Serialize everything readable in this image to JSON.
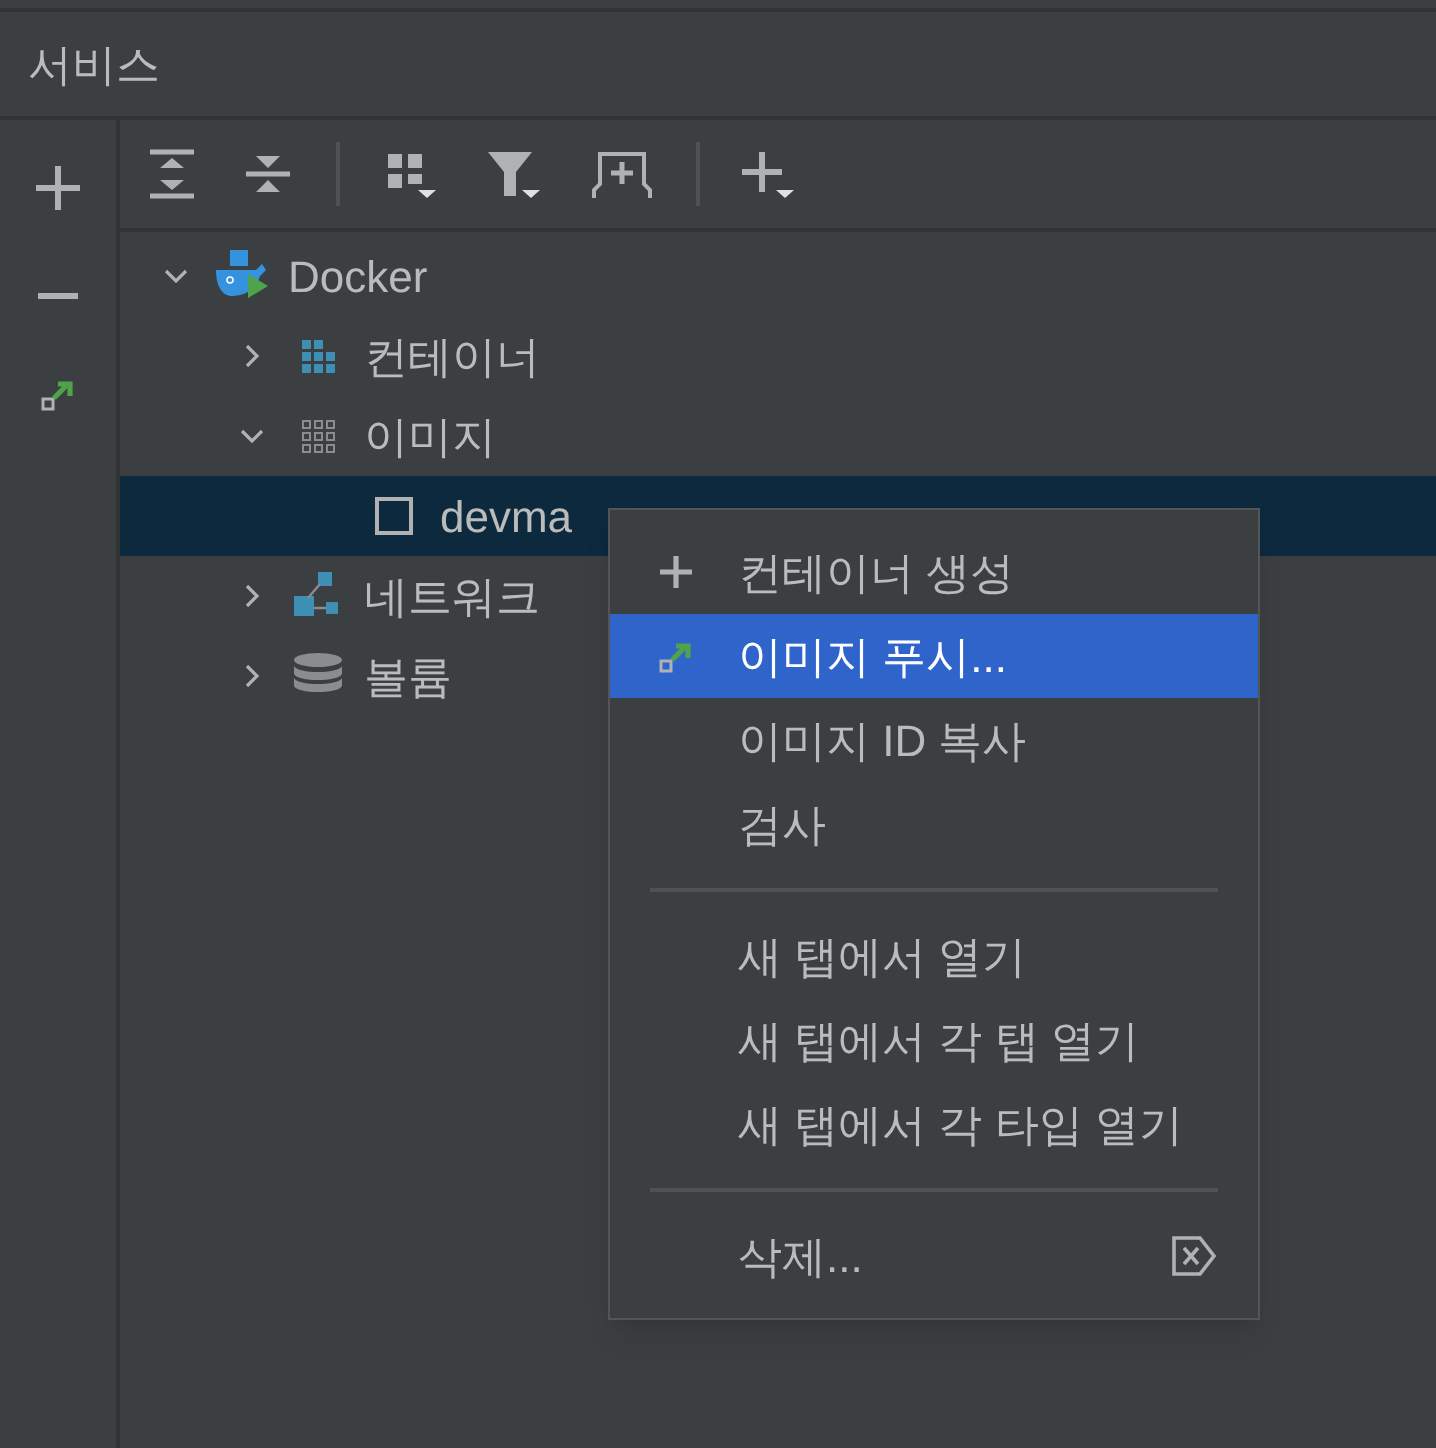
{
  "panel": {
    "title": "서비스"
  },
  "tree": [
    {
      "label": "Docker",
      "kind": "docker",
      "expanded": true,
      "selected": false,
      "children": [
        {
          "label": "컨테이너",
          "kind": "containers",
          "expanded": false,
          "selected": false
        },
        {
          "label": "이미지",
          "kind": "images",
          "expanded": true,
          "selected": false,
          "children": [
            {
              "label": "devma",
              "kind": "image",
              "selected": true
            }
          ]
        },
        {
          "label": "네트워크",
          "kind": "networks",
          "expanded": false,
          "selected": false
        },
        {
          "label": "볼륨",
          "kind": "volumes",
          "expanded": false,
          "selected": false
        }
      ]
    }
  ],
  "context_menu": [
    {
      "kind": "create",
      "label": "컨테이너 생성",
      "selected": false
    },
    {
      "kind": "push",
      "label": "이미지 푸시...",
      "selected": true
    },
    {
      "kind": "plain",
      "label": "이미지 ID 복사",
      "selected": false
    },
    {
      "kind": "plain",
      "label": "검사",
      "selected": false
    },
    {
      "kind": "separator"
    },
    {
      "kind": "plain",
      "label": "새 탭에서 열기",
      "selected": false
    },
    {
      "kind": "plain",
      "label": "새 탭에서 각 탭 열기",
      "selected": false
    },
    {
      "kind": "plain",
      "label": "새 탭에서 각 타입 열기",
      "selected": false
    },
    {
      "kind": "separator"
    },
    {
      "kind": "delete",
      "label": "삭제...",
      "selected": false
    }
  ]
}
